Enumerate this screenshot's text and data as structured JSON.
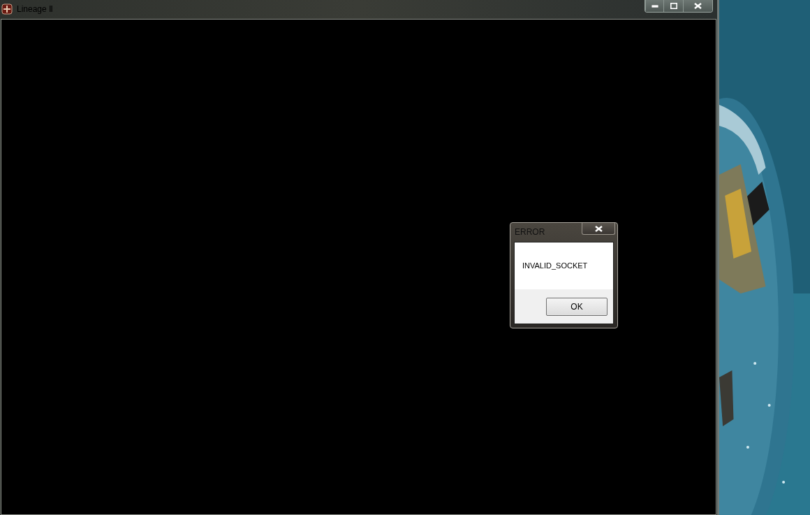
{
  "window": {
    "title": "Lineage Ⅱ",
    "caption_buttons": [
      {
        "kind": "minimize"
      },
      {
        "kind": "maximize"
      },
      {
        "kind": "close"
      }
    ]
  },
  "dialog": {
    "title": "ERROR",
    "message": "INVALID_SOCKET",
    "buttons": [
      "OK"
    ]
  }
}
